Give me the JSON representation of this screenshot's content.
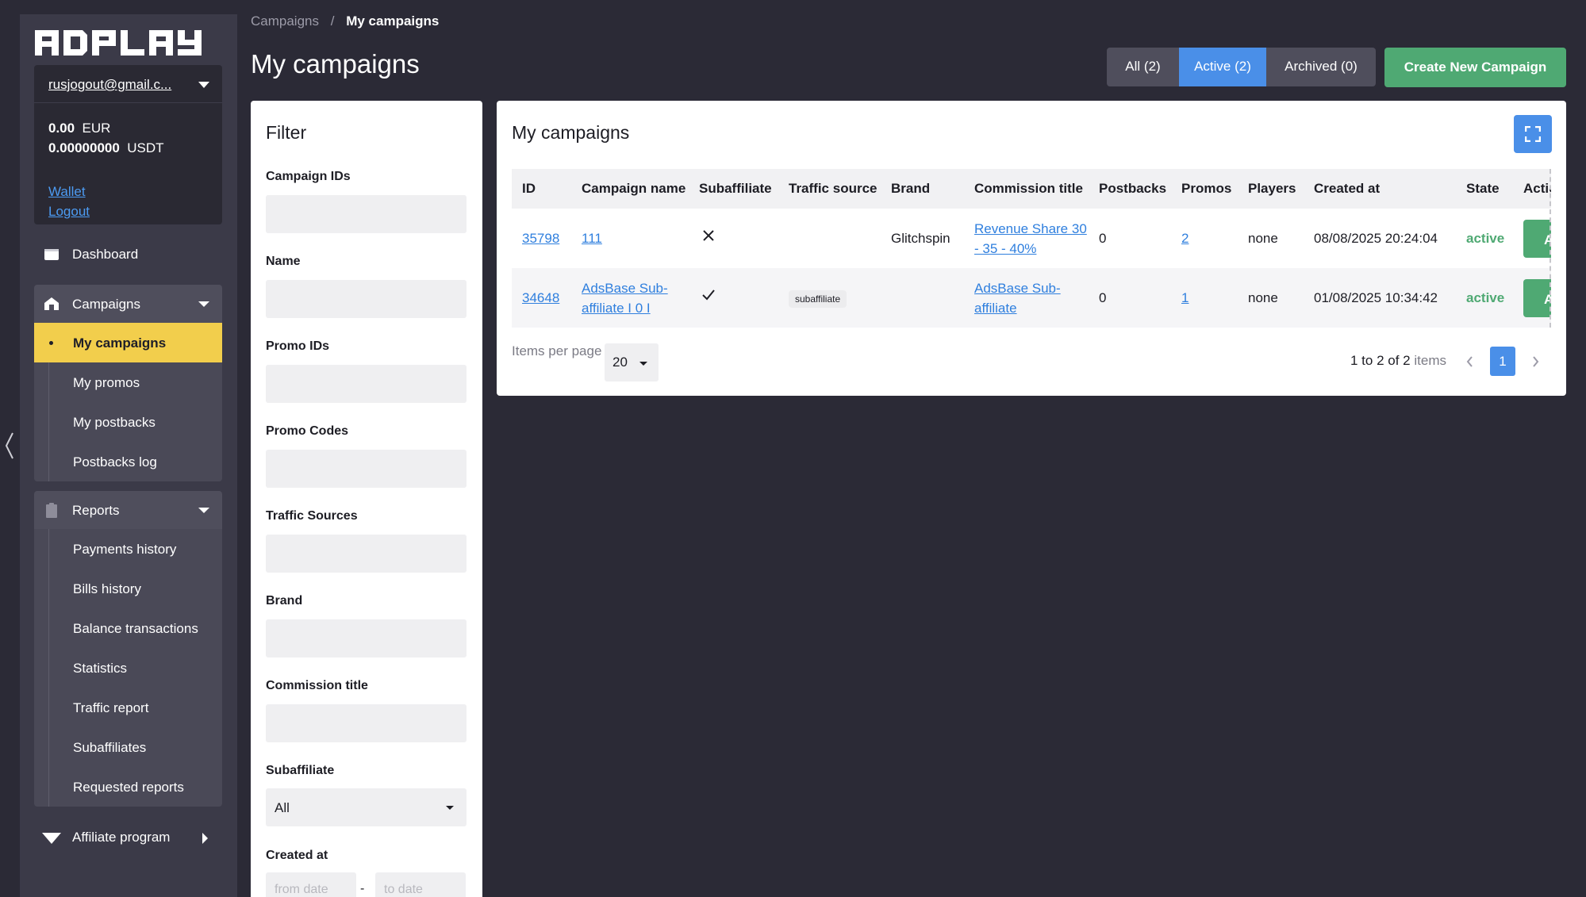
{
  "logo": {
    "text": "ADPLAY"
  },
  "account": {
    "email": "rusjogout@gmail.c...",
    "balances": [
      {
        "amount": "0.00",
        "currency": "EUR"
      },
      {
        "amount": "0.00000000",
        "currency": "USDT"
      }
    ],
    "wallet_label": "Wallet",
    "logout_label": "Logout"
  },
  "nav": {
    "dashboard": "Dashboard",
    "campaigns": {
      "label": "Campaigns",
      "items": [
        "My campaigns",
        "My promos",
        "My postbacks",
        "Postbacks log"
      ]
    },
    "reports": {
      "label": "Reports",
      "items": [
        "Payments history",
        "Bills history",
        "Balance transactions",
        "Statistics",
        "Traffic report",
        "Subaffiliates",
        "Requested reports"
      ]
    },
    "affiliate_program": "Affiliate program"
  },
  "breadcrumb": {
    "parent": "Campaigns",
    "separator": "/",
    "current": "My campaigns"
  },
  "page_title": "My campaigns",
  "segments": {
    "all": "All (2)",
    "active": "Active (2)",
    "archived": "Archived (0)"
  },
  "create_button": "Create New Campaign",
  "filter": {
    "title": "Filter",
    "labels": {
      "campaign_ids": "Campaign IDs",
      "name": "Name",
      "promo_ids": "Promo IDs",
      "promo_codes": "Promo Codes",
      "traffic_sources": "Traffic Sources",
      "brand": "Brand",
      "commission_title": "Commission title",
      "subaffiliate": "Subaffiliate",
      "created_at": "Created at"
    },
    "subaffiliate_value": "All",
    "from_date_placeholder": "from date",
    "to_date_placeholder": "to date",
    "date_separator": "-"
  },
  "panel": {
    "title": "My campaigns",
    "columns": [
      "ID",
      "Campaign name",
      "Subaffiliate",
      "Traffic source",
      "Brand",
      "Commission title",
      "Postbacks",
      "Promos",
      "Players",
      "Created at",
      "State",
      "Actio"
    ],
    "rows": [
      {
        "id": "35798",
        "name": "111",
        "subaffiliate": "no",
        "traffic_source": "",
        "brand": "Glitchspin",
        "commission": "Revenue Share 30 - 35 - 40%",
        "postbacks": "0",
        "promos": "2",
        "players": "none",
        "created_at": "08/08/2025 20:24:04",
        "state": "active",
        "action": "A"
      },
      {
        "id": "34648",
        "name": "AdsBase Sub-affiliate I 0 I",
        "subaffiliate": "yes",
        "traffic_source": "subaffiliate",
        "brand": "",
        "commission": "AdsBase Sub-affiliate",
        "postbacks": "0",
        "promos": "1",
        "players": "none",
        "created_at": "01/08/2025 10:34:42",
        "state": "active",
        "action": "A"
      }
    ],
    "items_per_page_label": "Items per page",
    "items_per_page_value": "20",
    "range_text": "1 to 2 of 2",
    "items_word": "items",
    "current_page": "1"
  },
  "colors": {
    "background": "#2b2a36",
    "sidebar": "#3b3a48",
    "accent_blue": "#4a8fe8",
    "accent_green": "#4fa973",
    "active_yellow": "#f2ce4c",
    "link": "#2f7fde"
  }
}
